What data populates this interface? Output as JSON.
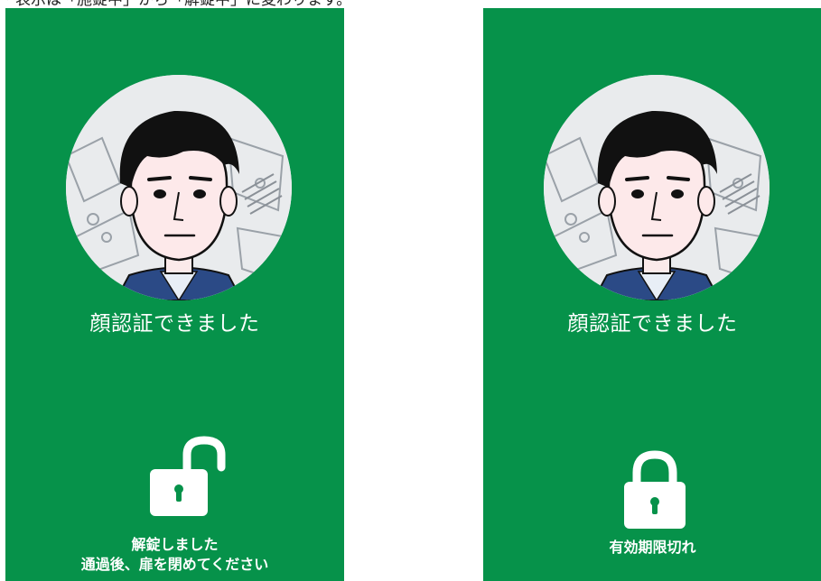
{
  "caption": "・表示は「施錠中」から「解錠中」に変わります。",
  "panels": [
    {
      "title": "顔認証できました",
      "lock_state": "unlocked",
      "icon": "lock-open-icon",
      "message_lines": [
        "解錠しました",
        "通過後、扉を閉めてください"
      ]
    },
    {
      "title": "顔認証できました",
      "lock_state": "locked",
      "icon": "lock-closed-icon",
      "message_lines": [
        "有効期限切れ"
      ]
    }
  ],
  "colors": {
    "panel_background": "#06924a",
    "text": "#ffffff",
    "page_background": "#ffffff"
  }
}
